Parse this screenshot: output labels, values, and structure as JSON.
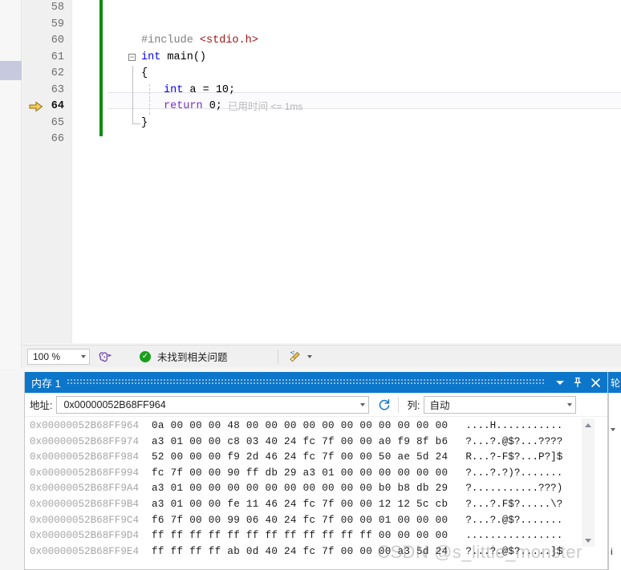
{
  "editor": {
    "lines": [
      {
        "num": "58",
        "tokens": []
      },
      {
        "num": "59",
        "tokens": []
      },
      {
        "num": "60",
        "text": "#include <stdio.h>"
      },
      {
        "num": "61",
        "text": "int main()"
      },
      {
        "num": "62",
        "text": "{"
      },
      {
        "num": "63",
        "text": "int a = 10;"
      },
      {
        "num": "64",
        "text": "return 0;"
      },
      {
        "num": "65",
        "text": "}"
      },
      {
        "num": "66",
        "text": ""
      }
    ],
    "code": {
      "include_directive": "#include",
      "include_header": "<stdio.h>",
      "int_kw": "int",
      "main_name": "main()",
      "open_brace": "{",
      "decl_int": "int",
      "decl_var": " a = 10;",
      "return_kw": "return",
      "return_val": " 0;",
      "close_brace": "}",
      "fold_glyph": "−"
    },
    "elapsed_label": "已用时间",
    "elapsed_value": "<= 1ms",
    "active_line": "64",
    "exec_pointer_icon": "execution-arrow-icon"
  },
  "statusbar": {
    "zoom_level": "100 %",
    "zoom_caret_icon": "chevron-down-icon",
    "intellisense_icon": "intellisense-head-icon",
    "problem_status": "未找到相关问题",
    "problem_ok_icon": "check-circle-icon",
    "broom_icon": "code-cleanup-broom-icon",
    "broom_caret_icon": "chevron-down-icon"
  },
  "memory_window": {
    "title": "内存 1",
    "dropdown_icon": "chevron-down-icon",
    "pin_icon": "pin-icon",
    "close_icon": "close-icon",
    "address_label": "地址:",
    "address_value": "0x00000052B68FF964",
    "address_caret_icon": "chevron-down-icon",
    "refresh_icon": "refresh-icon",
    "columns_label": "列:",
    "columns_value": "自动",
    "columns_caret_icon": "chevron-down-icon",
    "scroll_up_icon": "scroll-up-arrow-icon",
    "scroll_down_icon": "scroll-down-arrow-icon",
    "rows": [
      {
        "address": "0x00000052B68FF964",
        "hex": "0a 00 00 00 48 00 00 00 00 00 00 00 00 00 00 00",
        "ascii": "....H..........."
      },
      {
        "address": "0x00000052B68FF974",
        "hex": "a3 01 00 00 c8 03 40 24 fc 7f 00 00 a0 f9 8f b6",
        "ascii": "?...?.@$?...????"
      },
      {
        "address": "0x00000052B68FF984",
        "hex": "52 00 00 00 f9 2d 46 24 fc 7f 00 00 50 ae 5d 24",
        "ascii": "R...?-F$?...P?]$"
      },
      {
        "address": "0x00000052B68FF994",
        "hex": "fc 7f 00 00 90 ff db 29 a3 01 00 00 00 00 00 00",
        "ascii": "?...?.?)?......."
      },
      {
        "address": "0x00000052B68FF9A4",
        "hex": "a3 01 00 00 00 00 00 00 00 00 00 00 b0 b8 db 29",
        "ascii": "?...........???)"
      },
      {
        "address": "0x00000052B68FF9B4",
        "hex": "a3 01 00 00 fe 11 46 24 fc 7f 00 00 12 12 5c cb",
        "ascii": "?...?.F$?.....\\?"
      },
      {
        "address": "0x00000052B68FF9C4",
        "hex": "f6 7f 00 00 99 06 40 24 fc 7f 00 00 01 00 00 00",
        "ascii": "?...?.@$?......."
      },
      {
        "address": "0x00000052B68FF9D4",
        "hex": "ff ff ff ff ff ff ff ff ff ff ff ff 00 00 00 00",
        "ascii": "................"
      },
      {
        "address": "0x00000052B68FF9E4",
        "hex": "ff ff ff ff ab 0d 40 24 fc 7f 00 00 00 a3 5d 24",
        "ascii": "?...?.@$?.....]$"
      }
    ]
  },
  "right_panel": {
    "title_char": "轮",
    "body_char": "i",
    "caret_icon": "chevron-down-icon"
  },
  "watermark": {
    "text": "CSDN @s_little_monster"
  },
  "colors": {
    "accent_blue": "#0c76ca",
    "keyword_blue": "#0000ff",
    "keyword_purple": "#7b2fbe",
    "string_red": "#a31515",
    "changebar_green": "#108b10",
    "address_gray": "#a6a6a6"
  }
}
